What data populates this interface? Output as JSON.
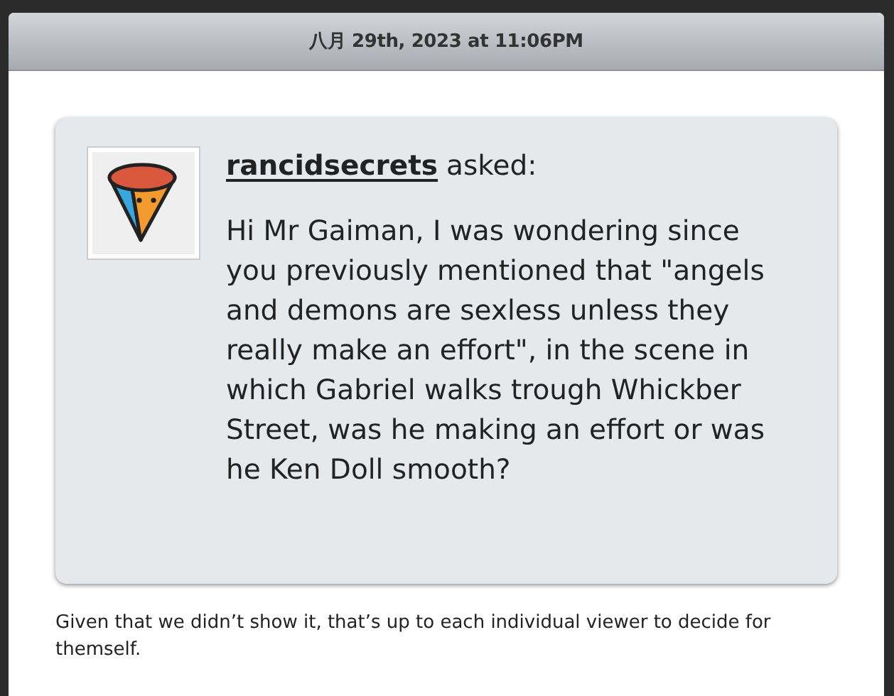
{
  "post": {
    "date": "八月 29th, 2023 at 11:06PM",
    "question": {
      "asker": "rancidsecrets",
      "verb": "asked:",
      "text": "Hi Mr Gaiman, I was wondering since you previously mentioned that \"angels and demons are sexless unless they really make an effort\", in the scene in which Gabriel walks trough Whickber Street, was he making an effort or was he Ken Doll smooth?"
    },
    "answer": "Given that we didn’t show it, that’s up to each individual viewer to decide for themself."
  }
}
